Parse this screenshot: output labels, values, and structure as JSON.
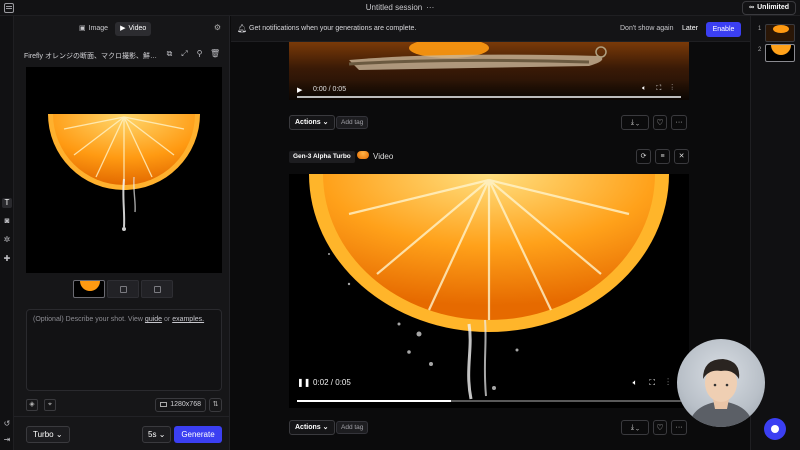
{
  "topbar": {
    "session_title": "Untitled session",
    "more": "···",
    "plan_badge": "Unlimited",
    "plan_icon": "∞"
  },
  "rail": {
    "items": [
      {
        "icon": "T",
        "name": "text-tool"
      },
      {
        "icon": "◙",
        "name": "camera-tool"
      },
      {
        "icon": "✲",
        "name": "motion-tool"
      },
      {
        "icon": "✚",
        "name": "add-tool"
      },
      {
        "icon": "↺",
        "name": "history-tool"
      },
      {
        "icon": "⇥",
        "name": "collapse-tool"
      }
    ]
  },
  "panel": {
    "modes": [
      {
        "label": "Image",
        "icon": "▣"
      },
      {
        "label": "Video",
        "icon": "▶"
      }
    ],
    "active_mode": "Video",
    "settings_icon": "⚙",
    "prompt_title": "Firefly オレンジの断面、マクロ撮影、鮮やか…",
    "prompt_tool_icons": [
      "⧉",
      "⤢",
      "⚲",
      "🗑"
    ],
    "description_placeholder_prefix": "(Optional) Describe your shot. View ",
    "description_link1": "guide",
    "description_or": " or ",
    "description_link2": "examples.",
    "resolution": "1280x768",
    "swap_icon": "⇅",
    "model": "Turbo",
    "duration": "5s",
    "generate_label": "Generate",
    "chevron": "⌄"
  },
  "notification": {
    "message": "Get notifications when your generations are complete.",
    "dont_show": "Don't show again",
    "later": "Later",
    "enable": "Enable"
  },
  "generations": [
    {
      "time": "0:00 / 0:05",
      "actions_label": "Actions",
      "add_tag_label": "Add tag"
    },
    {
      "model_badge": "Gen-3 Alpha Turbo",
      "type_label": "Video",
      "time": "0:02 / 0:05",
      "progress_fraction": 0.4,
      "actions_label": "Actions",
      "add_tag_label": "Add tag"
    }
  ],
  "strip": {
    "items": [
      "1",
      "2"
    ]
  },
  "colors": {
    "accent": "#3b3ff2",
    "orange": "#f39a14",
    "background": "#0b0b0c"
  }
}
